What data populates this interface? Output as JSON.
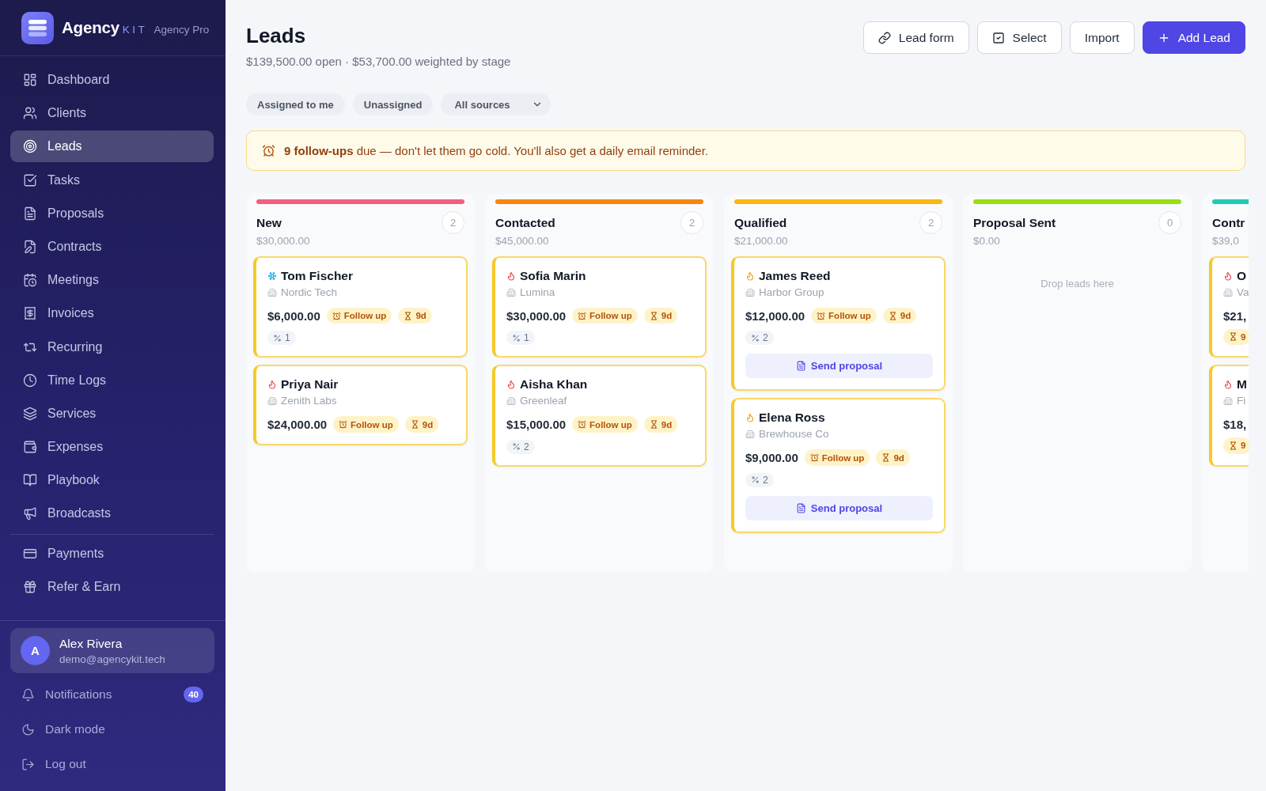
{
  "sidebar": {
    "brand": {
      "name": "Agency",
      "suffix": "KIT",
      "plan": "Agency Pro"
    },
    "nav": [
      {
        "label": "Dashboard",
        "selected": false
      },
      {
        "label": "Clients",
        "selected": false
      },
      {
        "label": "Leads",
        "selected": true
      },
      {
        "label": "Tasks",
        "selected": false
      },
      {
        "label": "Proposals",
        "selected": false
      },
      {
        "label": "Contracts",
        "selected": false
      },
      {
        "label": "Meetings",
        "selected": false
      },
      {
        "label": "Invoices",
        "selected": false
      },
      {
        "label": "Recurring",
        "selected": false
      },
      {
        "label": "Time Logs",
        "selected": false
      },
      {
        "label": "Services",
        "selected": false
      },
      {
        "label": "Expenses",
        "selected": false
      },
      {
        "label": "Playbook",
        "selected": false
      },
      {
        "label": "Broadcasts",
        "selected": false
      }
    ],
    "nav_more": [
      {
        "label": "Payments",
        "selected": false
      },
      {
        "label": "Refer & Earn",
        "selected": false
      }
    ],
    "user": {
      "initial": "A",
      "name": "Alex Rivera",
      "email": "demo@agencykit.tech"
    },
    "footer": [
      {
        "label": "Notifications",
        "badge": "40"
      },
      {
        "label": "Dark mode"
      },
      {
        "label": "Log out"
      }
    ]
  },
  "header": {
    "title": "Leads",
    "summary": "$139,500.00 open · $53,700.00 weighted by stage",
    "actions": [
      {
        "label": "Lead form",
        "kind": "secondary"
      },
      {
        "label": "Select",
        "kind": "secondary"
      },
      {
        "label": "Import",
        "kind": "secondary"
      },
      {
        "label": "Add Lead",
        "kind": "primary"
      }
    ]
  },
  "filters": [
    {
      "label": "Assigned to me",
      "kind": "chip"
    },
    {
      "label": "Unassigned",
      "kind": "chip"
    },
    {
      "label": "All sources",
      "kind": "select"
    }
  ],
  "banner": {
    "text": "**9 follow-ups** due — don't let them go cold. You'll also get a daily email reminder."
  },
  "board": {
    "columns": [
      {
        "title": "New",
        "count": "2",
        "total": "$30,000.00",
        "color": "#f25f7c",
        "leads": [
          {
            "name": "Tom Fischer",
            "kind": "cold",
            "company": "Nordic Tech",
            "value": "$6,000.00",
            "badges": [
              {
                "kind": "followup",
                "text": "Follow up"
              },
              {
                "kind": "age",
                "text": "9d"
              }
            ],
            "chips": [
              {
                "kind": "percent",
                "text": "1"
              }
            ]
          },
          {
            "name": "Priya Nair",
            "kind": "hot",
            "company": "Zenith Labs",
            "value": "$24,000.00",
            "badges": [
              {
                "kind": "followup",
                "text": "Follow up"
              },
              {
                "kind": "age",
                "text": "9d"
              }
            ]
          }
        ]
      },
      {
        "title": "Contacted",
        "count": "2",
        "total": "$45,000.00",
        "color": "#f7860f",
        "leads": [
          {
            "name": "Sofia Marin",
            "kind": "hot",
            "company": "Lumina",
            "value": "$30,000.00",
            "badges": [
              {
                "kind": "followup",
                "text": "Follow up"
              },
              {
                "kind": "age",
                "text": "9d"
              }
            ],
            "chips": [
              {
                "kind": "percent",
                "text": "1"
              }
            ]
          },
          {
            "name": "Aisha Khan",
            "kind": "hot",
            "company": "Greenleaf",
            "value": "$15,000.00",
            "badges": [
              {
                "kind": "followup",
                "text": "Follow up"
              },
              {
                "kind": "age",
                "text": "9d"
              }
            ],
            "chips": [
              {
                "kind": "percent",
                "text": "2"
              }
            ]
          }
        ]
      },
      {
        "title": "Qualified",
        "count": "2",
        "total": "$21,000.00",
        "color": "#fbb70f",
        "leads": [
          {
            "name": "James Reed",
            "kind": "warm",
            "company": "Harbor Group",
            "value": "$12,000.00",
            "badges": [
              {
                "kind": "followup",
                "text": "Follow up"
              },
              {
                "kind": "age",
                "text": "9d"
              }
            ],
            "chips": [
              {
                "kind": "percent",
                "text": "2"
              }
            ],
            "action": "Send proposal"
          },
          {
            "name": "Elena Ross",
            "kind": "warm",
            "company": "Brewhouse Co",
            "value": "$9,000.00",
            "badges": [
              {
                "kind": "followup",
                "text": "Follow up"
              },
              {
                "kind": "age",
                "text": "9d"
              }
            ],
            "chips": [
              {
                "kind": "percent",
                "text": "2"
              }
            ],
            "action": "Send proposal"
          }
        ]
      },
      {
        "title": "Proposal Sent",
        "count": "0",
        "total": "$0.00",
        "color": "#98df12",
        "empty_hint": "Drop leads here"
      },
      {
        "title": "Contr",
        "total": "$39,0",
        "color": "#1fcbb6",
        "leads": [
          {
            "name": "O",
            "kind": "hot",
            "company": "Va",
            "value": "$21,",
            "badges": [
              {
                "kind": "age",
                "text": "9"
              }
            ]
          },
          {
            "name": "M",
            "kind": "hot",
            "company": "Fi",
            "value": "$18,",
            "badges": [
              {
                "kind": "age",
                "text": "9"
              }
            ]
          }
        ]
      }
    ]
  }
}
